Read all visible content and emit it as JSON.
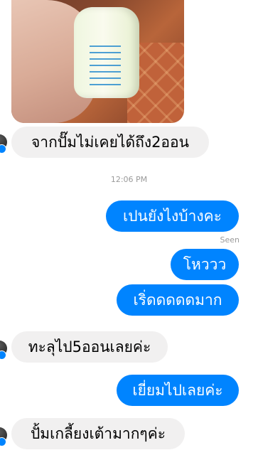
{
  "conversation": {
    "timestamp": "12:06 PM",
    "seen_label": "Seen",
    "messages": [
      {
        "side": "in",
        "text": "จากปั๊มไม่เคยได้ถึง2ออน"
      },
      {
        "side": "out",
        "text": "เปนยังไงบ้างคะ"
      },
      {
        "side": "out",
        "text": "โหววว"
      },
      {
        "side": "out",
        "text": "เริ่ดดดดดมาก"
      },
      {
        "side": "in",
        "text": "ทะลุไป5ออนเลยค่ะ"
      },
      {
        "side": "out",
        "text": "เยี่ยมไปเลยค่ะ"
      },
      {
        "side": "in",
        "text": "ปั้มเกลี้ยงเต้ามากๆค่ะ"
      }
    ]
  },
  "colors": {
    "outgoing_bubble": "#0084ff",
    "incoming_bubble": "#f1f0f0",
    "messenger_badge": "#0084ff"
  },
  "icons": {
    "avatar": "contact-avatar",
    "badge": "messenger-badge-icon"
  }
}
